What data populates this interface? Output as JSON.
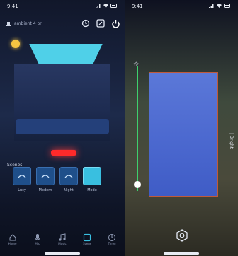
{
  "left": {
    "status": {
      "time": "9:41"
    },
    "topbar": {
      "device_name": "ambient 4 bri"
    },
    "scene_label": "Scenes",
    "scenes": [
      {
        "label": "Lucy",
        "active": false
      },
      {
        "label": "Modern",
        "active": false
      },
      {
        "label": "Night",
        "active": false
      },
      {
        "label": "Mode",
        "active": true
      }
    ],
    "nav": [
      "Home",
      "Mic",
      "Music",
      "Scene",
      "Timer"
    ],
    "accent": "#39bfe0",
    "red_light": "#ff2a2a"
  },
  "right": {
    "status": {
      "time": "9:41"
    },
    "brightness_level": 0.05,
    "edge_label": "| Bright"
  }
}
